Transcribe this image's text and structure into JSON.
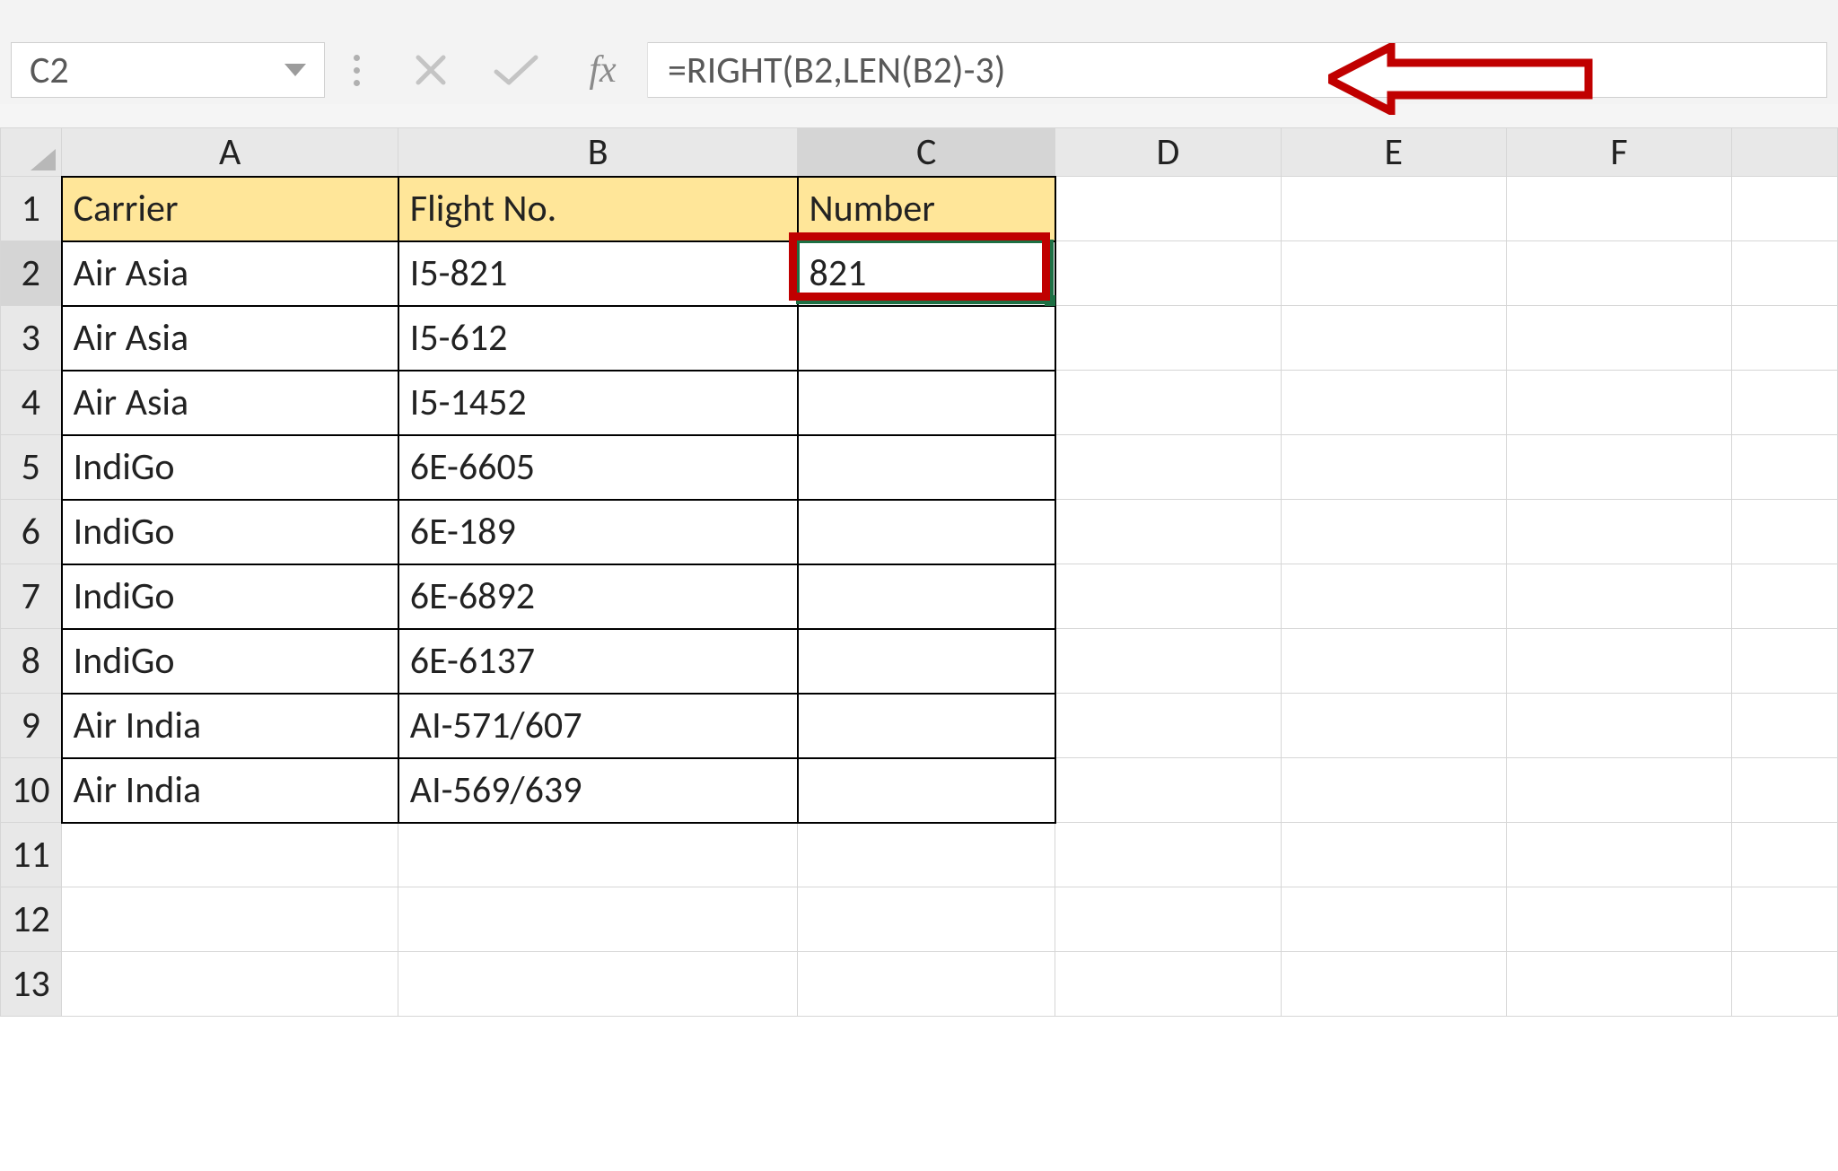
{
  "formula_bar": {
    "cell_ref": "C2",
    "fx_label": "fx",
    "formula": "=RIGHT(B2,LEN(B2)-3)"
  },
  "columns": [
    "A",
    "B",
    "C",
    "D",
    "E",
    "F"
  ],
  "rows": [
    "1",
    "2",
    "3",
    "4",
    "5",
    "6",
    "7",
    "8",
    "9",
    "10",
    "11",
    "12",
    "13"
  ],
  "headers": {
    "a": "Carrier",
    "b": "Flight No.",
    "c": "Number"
  },
  "data": [
    {
      "a": "Air Asia",
      "b": "I5-821",
      "c": "821"
    },
    {
      "a": "Air Asia",
      "b": "I5-612",
      "c": ""
    },
    {
      "a": "Air Asia",
      "b": "I5-1452",
      "c": ""
    },
    {
      "a": "IndiGo",
      "b": "6E-6605",
      "c": ""
    },
    {
      "a": "IndiGo",
      "b": "6E-189",
      "c": ""
    },
    {
      "a": "IndiGo",
      "b": "6E-6892",
      "c": ""
    },
    {
      "a": "IndiGo",
      "b": "6E-6137",
      "c": ""
    },
    {
      "a": "Air India",
      "b": "AI-571/607",
      "c": ""
    },
    {
      "a": "Air India",
      "b": "AI-569/639",
      "c": ""
    }
  ],
  "colors": {
    "header_fill": "#ffe699",
    "selection_border": "#1d7044",
    "annotation_red": "#c00000"
  }
}
